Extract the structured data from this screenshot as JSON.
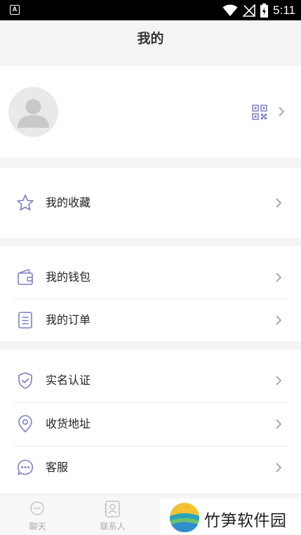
{
  "status_bar": {
    "time": "5:11",
    "app_badge": "A"
  },
  "header": {
    "title": "我的"
  },
  "menu": {
    "favorites": "我的收藏",
    "wallet": "我的钱包",
    "orders": "我的订单",
    "verification": "实名认证",
    "address": "收货地址",
    "customer_service": "客服"
  },
  "tab_bar": {
    "chat": "聊天",
    "contacts": "联系人"
  },
  "watermark": {
    "text": "竹笋软件园"
  },
  "colors": {
    "icon_accent": "#7b7fc4",
    "chevron": "#9a9a9a",
    "tab_inactive": "#aaaaaa"
  }
}
